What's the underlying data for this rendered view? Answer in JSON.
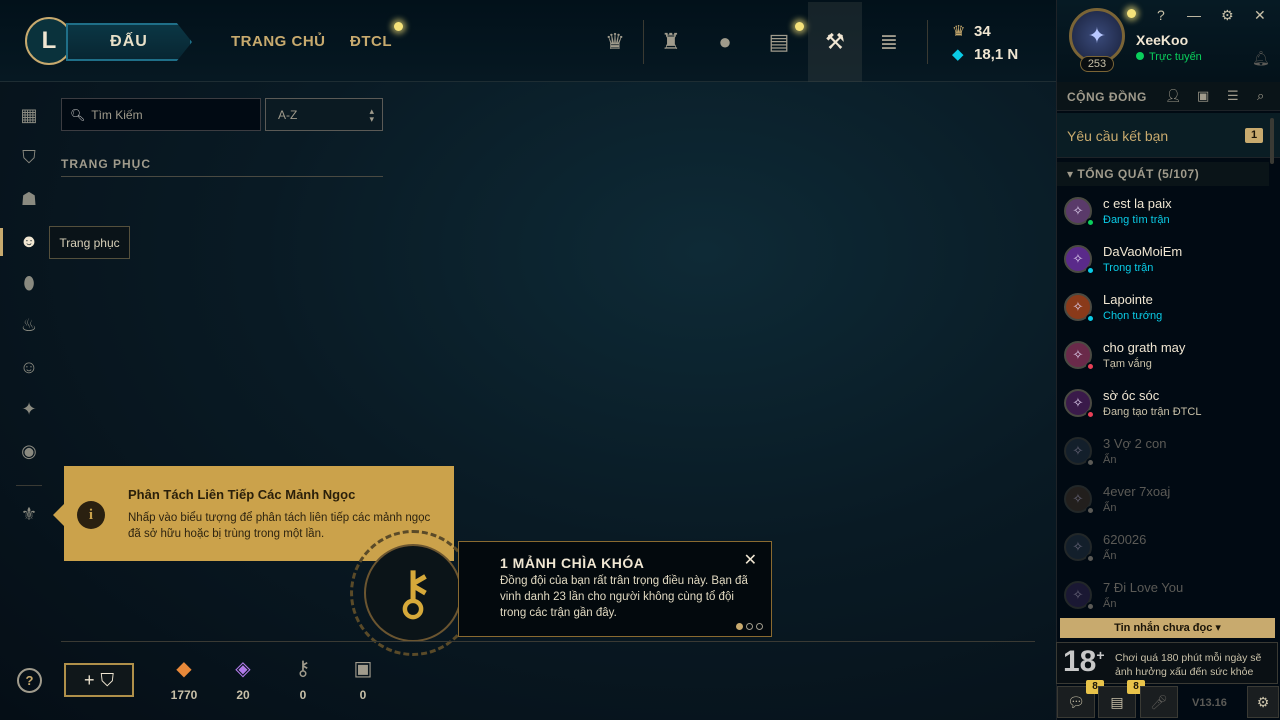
{
  "topbar": {
    "play_label": "ĐẤU",
    "logo_label": "L",
    "nav": [
      "TRANG CHỦ",
      "ĐTCL"
    ],
    "icons": [
      "rank-icon",
      "clash-icon",
      "profile-icon",
      "collection-icon",
      "loot-icon",
      "store-icon"
    ],
    "currency": {
      "blue_essence": "34",
      "rp": "18,1 N"
    }
  },
  "sidebar": {
    "items": [
      "grid-icon",
      "champions-icon",
      "helmet-icon",
      "mask-icon",
      "ward-icon",
      "emote-icon",
      "smiley-icon",
      "spell-icon",
      "icons-icon",
      "tft-icon"
    ],
    "tooltip": "Trang phục",
    "help": "?"
  },
  "main": {
    "search_placeholder": "Tìm Kiếm",
    "sort_value": "A-Z",
    "section_title": "TRANG PHỤC"
  },
  "tip": {
    "icon": "i",
    "title": "Phân Tách Liên Tiếp Các Mảnh Ngọc",
    "body": "Nhấp vào biểu tượng để phân tách liên tiếp các mảnh ngọc đã sở hữu hoặc bị trùng trong một lần."
  },
  "honor": {
    "title": "1 MẢNH CHÌA KHÓA",
    "body": "Đồng đội của bạn rất trân trọng điều này. Bạn đã vinh danh 23 lần cho người không cùng tổ đội trong các trận gần đây.",
    "close": "✕"
  },
  "bottom": {
    "add_label": "+",
    "resources": [
      {
        "icon": "orange-essence-icon",
        "value": "1770",
        "color": "#e8893a",
        "glyph": "◆"
      },
      {
        "icon": "mythic-essence-icon",
        "value": "20",
        "color": "#b07ae8",
        "glyph": "◈"
      },
      {
        "icon": "key-icon",
        "value": "0",
        "color": "#a09b8c",
        "glyph": "⚷"
      },
      {
        "icon": "chest-icon",
        "value": "0",
        "color": "#a09b8c",
        "glyph": "▣"
      }
    ]
  },
  "profile": {
    "name": "XeeKoo",
    "status": "Trực tuyến",
    "level": "253",
    "controls": [
      "?",
      "—",
      "⚙",
      "✕"
    ]
  },
  "social": {
    "header": "CỘNG ĐỒNG",
    "friend_request_label": "Yêu cầu kết bạn",
    "friend_request_count": "1",
    "group_label": "TỔNG QUÁT (5/107)",
    "friends": [
      {
        "name": "c est la paix",
        "status": "Đang tìm trận",
        "status_color": "#0acbe6",
        "dot": "#0acf5c",
        "online": true,
        "avatar_bg": "#5a3a6a"
      },
      {
        "name": "DaVaoMoiEm",
        "status": "Trong trận",
        "status_color": "#0acbe6",
        "dot": "#0acbe6",
        "online": true,
        "avatar_bg": "#5a2a8a"
      },
      {
        "name": "Lapointe",
        "status": "Chọn tướng",
        "status_color": "#0acbe6",
        "dot": "#0acbe6",
        "online": true,
        "avatar_bg": "#8a3a1a"
      },
      {
        "name": "cho grath may",
        "status": "Tạm vắng",
        "status_color": "#c8c0a8",
        "dot": "#e84057",
        "online": true,
        "avatar_bg": "#6a2a4a"
      },
      {
        "name": "sờ óc sóc",
        "status": "Đang tạo trận ĐTCL",
        "status_color": "#c8c0a8",
        "dot": "#e84057",
        "online": true,
        "avatar_bg": "#3a1a4a"
      },
      {
        "name": "3 Vợ 2 con",
        "status": "Ẩn",
        "status_color": "#5b5a56",
        "dot": "#5b5a56",
        "online": false,
        "avatar_bg": "#2a3a4a"
      },
      {
        "name": "4ever 7xoaj",
        "status": "Ẩn",
        "status_color": "#5b5a56",
        "dot": "#5b5a56",
        "online": false,
        "avatar_bg": "#4a3a2a"
      },
      {
        "name": "620026",
        "status": "Ẩn",
        "status_color": "#5b5a56",
        "dot": "#5b5a56",
        "online": false,
        "avatar_bg": "#2a3a4a"
      },
      {
        "name": "7 Đi Love You",
        "status": "Ẩn",
        "status_color": "#5b5a56",
        "dot": "#5b5a56",
        "online": false,
        "avatar_bg": "#3a2a5a"
      }
    ],
    "unread_label": "Tin nhắn chưa đọc ▾",
    "age_rating": "18",
    "warning": "Chơi quá 180 phút mỗi ngày sẽ ảnh hưởng xấu đến sức khỏe",
    "chat_badge": "8",
    "notif_badge": "8",
    "version": "V13.16"
  }
}
